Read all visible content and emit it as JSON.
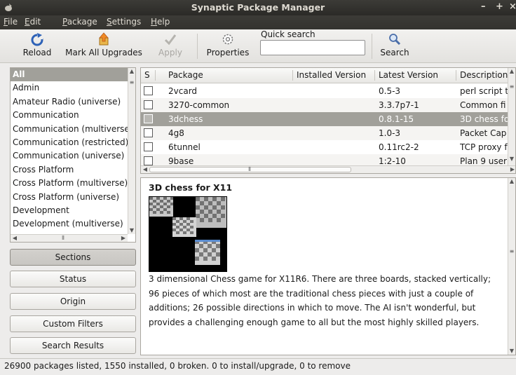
{
  "window": {
    "title": "Synaptic Package Manager",
    "controls": [
      "–",
      "+",
      "×"
    ]
  },
  "menu": [
    "File",
    "Edit",
    "Package",
    "Settings",
    "Help"
  ],
  "toolbar": {
    "reload": "Reload",
    "mark_all": "Mark All Upgrades",
    "apply": "Apply",
    "properties": "Properties",
    "quick_search_label": "Quick search",
    "quick_search_value": "",
    "search": "Search"
  },
  "sections": {
    "items": [
      "All",
      "Admin",
      "Amateur Radio (universe)",
      "Communication",
      "Communication (multiverse)",
      "Communication (restricted)",
      "Communication (universe)",
      "Cross Platform",
      "Cross Platform (multiverse)",
      "Cross Platform (universe)",
      "Development",
      "Development (multiverse)"
    ],
    "selected": 0
  },
  "filters": [
    "Sections",
    "Status",
    "Origin",
    "Custom Filters",
    "Search Results"
  ],
  "table": {
    "headers": [
      "S",
      "Package",
      "Installed Version",
      "Latest Version",
      "Description"
    ],
    "rows": [
      {
        "package": "2vcard",
        "installed": "",
        "latest": "0.5-3",
        "desc": "perl script t"
      },
      {
        "package": "3270-common",
        "installed": "",
        "latest": "3.3.7p7-1",
        "desc": "Common fi"
      },
      {
        "package": "3dchess",
        "installed": "",
        "latest": "0.8.1-15",
        "desc": "3D chess fo"
      },
      {
        "package": "4g8",
        "installed": "",
        "latest": "1.0-3",
        "desc": "Packet Cap"
      },
      {
        "package": "6tunnel",
        "installed": "",
        "latest": "0.11rc2-2",
        "desc": "TCP proxy f"
      },
      {
        "package": "9base",
        "installed": "",
        "latest": "1:2-10",
        "desc": "Plan 9 user"
      }
    ],
    "selected_row": 2
  },
  "description": {
    "title": "3D chess for X11",
    "text": "3 dimensional Chess game for X11R6.  There are three boards, stacked vertically; 96 pieces of which most are the traditional chess pieces with just a couple of additions; 26 possible directions in which to move.  The AI isn't wonderful, but provides a challenging enough game to all but the most highly skilled players."
  },
  "status": "26900 packages listed, 1550 installed, 0 broken. 0 to install/upgrade, 0 to remove",
  "colors": {
    "selection": "#a1a09a",
    "titlebar": "#3c3b37",
    "window_bg": "#edeceb"
  }
}
